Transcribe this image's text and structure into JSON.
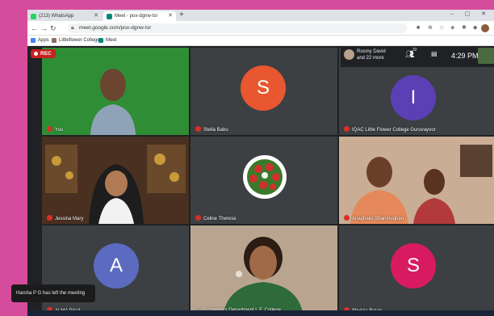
{
  "browser": {
    "tabs": [
      {
        "label": "(213) WhatsApp",
        "color": "#25d366"
      },
      {
        "label": "Meet - pox-dgnw-tsr",
        "color": "#00897b"
      }
    ],
    "url": "meet.google.com/pox-dgnw-tsr",
    "bookmarks": [
      "Apps",
      "Littleflower College...",
      "Meet"
    ]
  },
  "meet": {
    "rec_label": "REC",
    "presenter_line1": "Rosmy David",
    "presenter_line2": "and 22 more",
    "participant_count": "32",
    "time": "4:29 PM",
    "toast": "Harsha P G has left the meeting",
    "tiles": [
      {
        "name": "You",
        "type": "video",
        "bg": "#2e8b2e"
      },
      {
        "name": "Stella Babu",
        "type": "avatar",
        "letter": "S",
        "color": "#e8572f"
      },
      {
        "name": "IQAC Little Flower College Guruvayoor",
        "type": "avatar",
        "letter": "I",
        "color": "#5b3fb5"
      },
      {
        "name": "Jessina Mary",
        "type": "video",
        "bg": "#5a3a22"
      },
      {
        "name": "Celine Therese",
        "type": "roses",
        "bg": "#3c4043"
      },
      {
        "name": "Anaghaks Shanmughan",
        "type": "video",
        "bg": "#c8a890"
      },
      {
        "name": "ALMA PAUL",
        "type": "avatar",
        "letter": "A",
        "color": "#5c6bc0"
      },
      {
        "name": "Economics Department L.F. College",
        "type": "video",
        "bg": "#b8a48e"
      },
      {
        "name": "Shylaja Rajan",
        "type": "avatar",
        "letter": "S",
        "color": "#d81b60"
      }
    ]
  }
}
